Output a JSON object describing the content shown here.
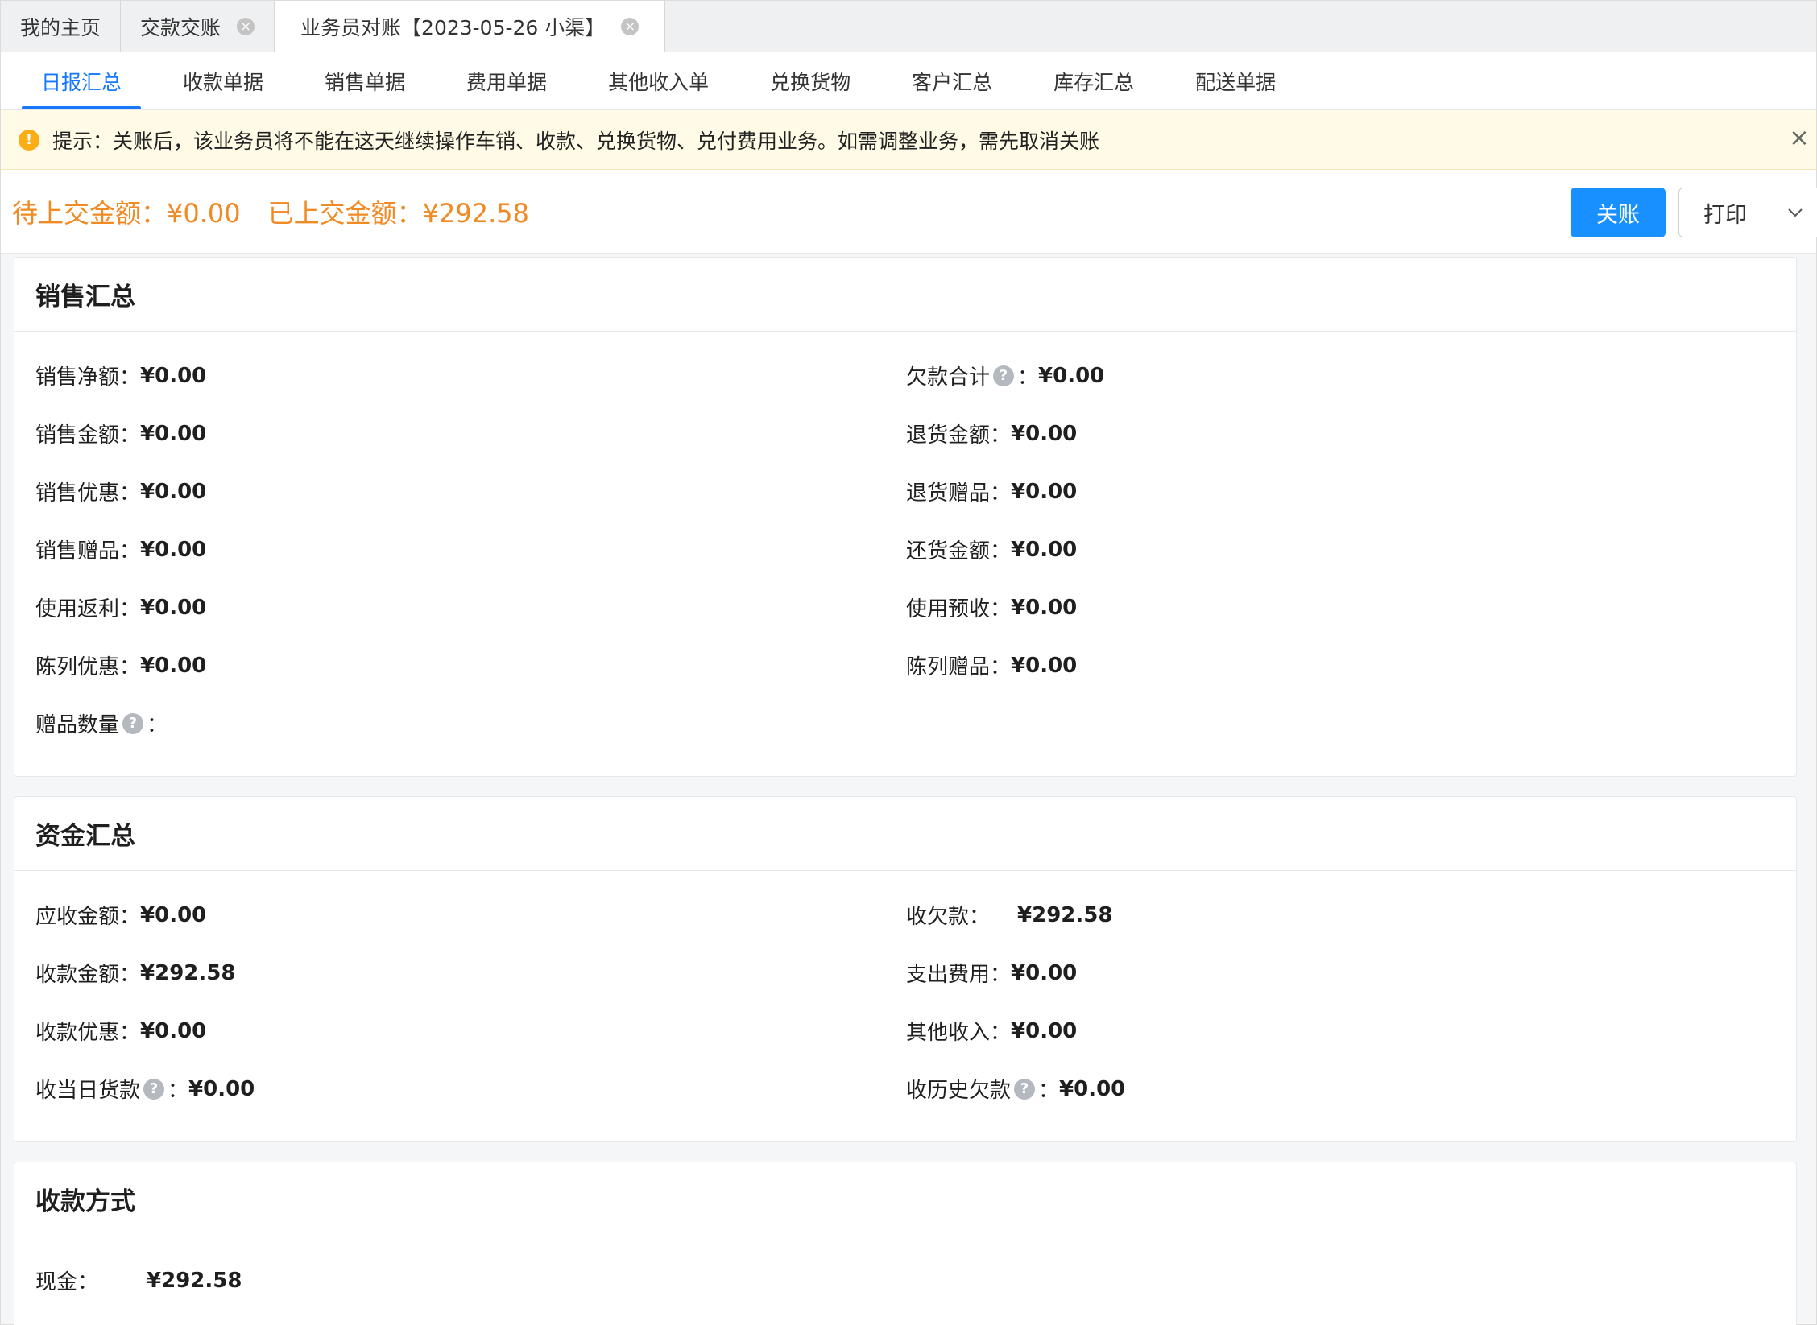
{
  "tabs": [
    {
      "label": "我的主页"
    },
    {
      "label": "交款交账"
    },
    {
      "label": "业务员对账【2023-05-26 小渠】"
    }
  ],
  "subtabs": [
    "日报汇总",
    "收款单据",
    "销售单据",
    "费用单据",
    "其他收入单",
    "兑换货物",
    "客户汇总",
    "库存汇总",
    "配送单据"
  ],
  "alert": {
    "text": "提示：关账后，该业务员将不能在这天继续操作车销、收款、兑换货物、兑付费用业务。如需调整业务，需先取消关账"
  },
  "summary": {
    "pending": "待上交金额：¥0.00",
    "submitted": "已上交金额：¥292.58"
  },
  "buttons": {
    "close_account": "关账",
    "print": "打印"
  },
  "sales": {
    "title": "销售汇总",
    "left": [
      {
        "label": "销售净额：",
        "value": "¥0.00"
      },
      {
        "label": "销售金额：",
        "value": "¥0.00"
      },
      {
        "label": "销售优惠：",
        "value": "¥0.00"
      },
      {
        "label": "销售赠品：",
        "value": "¥0.00"
      },
      {
        "label": "使用返利：",
        "value": "¥0.00"
      },
      {
        "label": "陈列优惠：",
        "value": "¥0.00"
      },
      {
        "label": "赠品数量",
        "suffix": "：",
        "value": ""
      }
    ],
    "right": [
      {
        "label": "欠款合计",
        "suffix": "：",
        "value": "¥0.00"
      },
      {
        "label": "退货金额：",
        "value": "¥0.00"
      },
      {
        "label": "退货赠品：",
        "value": "¥0.00"
      },
      {
        "label": "还货金额：",
        "value": "¥0.00"
      },
      {
        "label": "使用预收：",
        "value": "¥0.00"
      },
      {
        "label": "陈列赠品：",
        "value": "¥0.00"
      }
    ]
  },
  "funds": {
    "title": "资金汇总",
    "left": [
      {
        "label": "应收金额：",
        "value": "¥0.00"
      },
      {
        "label": "收款金额：",
        "value": "¥292.58"
      },
      {
        "label": "收款优惠：",
        "value": "¥0.00"
      },
      {
        "label": "收当日货款",
        "suffix": "：",
        "value": "¥0.00"
      }
    ],
    "right": [
      {
        "label": "收欠款：",
        "value": "¥292.58"
      },
      {
        "label": "支出费用：",
        "value": "¥0.00"
      },
      {
        "label": "其他收入：",
        "value": "¥0.00"
      },
      {
        "label": "收历史欠款",
        "suffix": "：",
        "value": "¥0.00"
      }
    ]
  },
  "payment": {
    "title": "收款方式",
    "items": [
      {
        "label": "现金：",
        "value": "¥292.58"
      }
    ]
  }
}
